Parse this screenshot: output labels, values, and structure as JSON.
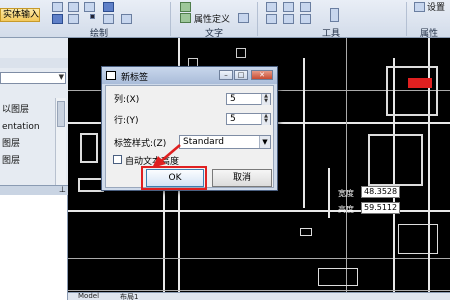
{
  "ribbon": {
    "mtext_label": "实体输入",
    "groups": {
      "draw": "绘制",
      "text": "文字",
      "tools": "工具",
      "properties": "属性"
    },
    "text_items": [
      "属性定义"
    ],
    "tail_label": "设置"
  },
  "left_panel": {
    "items": [
      "以图层",
      "entation",
      "图层",
      "图层",
      "图层"
    ]
  },
  "canvas": {
    "tabs": [
      "Model",
      "布局1"
    ]
  },
  "measure": {
    "width_label": "宽度",
    "width_value": "48.3528",
    "height_label": "高度",
    "height_value": "59.5112"
  },
  "dialog": {
    "title": "新标签",
    "columns_label": "列:(X)",
    "columns_value": "5",
    "rows_label": "行:(Y)",
    "rows_value": "5",
    "style_label": "标签样式:(Z)",
    "style_value": "Standard",
    "auto_height_label": "自动文本高度",
    "ok_label": "OK",
    "cancel_label": "取消"
  },
  "colors": {
    "highlight": "#e02020",
    "canvas": "#000000",
    "ribbon": "#d3dcea"
  }
}
